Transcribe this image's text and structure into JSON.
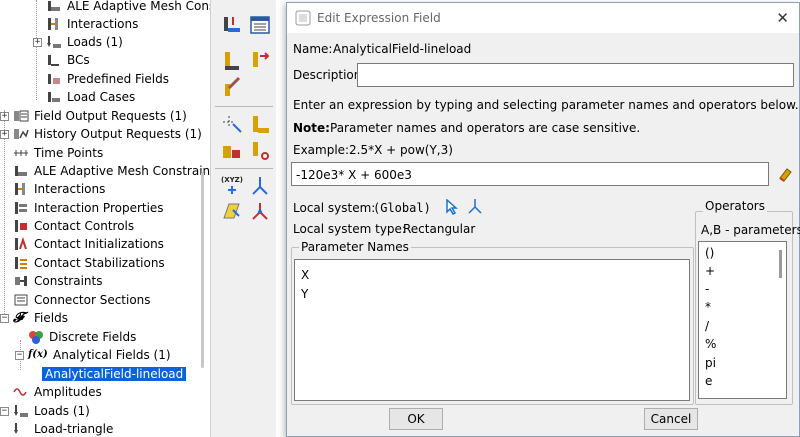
{
  "tree": {
    "items": [
      {
        "label": "ALE Adaptive Mesh Cons",
        "icon": "ale-mesh-icon"
      },
      {
        "label": "Interactions",
        "icon": "interaction-icon"
      },
      {
        "label": "Loads (1)",
        "icon": "load-icon"
      },
      {
        "label": "BCs",
        "icon": "bc-icon"
      },
      {
        "label": "Predefined Fields",
        "icon": "predefined-field-icon"
      },
      {
        "label": "Load Cases",
        "icon": "load-case-icon"
      },
      {
        "label": "Field Output Requests (1)",
        "icon": "field-output-icon"
      },
      {
        "label": "History Output Requests (1)",
        "icon": "history-output-icon"
      },
      {
        "label": "Time Points",
        "icon": "time-points-icon"
      },
      {
        "label": "ALE Adaptive Mesh Constraints",
        "icon": "ale-mesh-icon"
      },
      {
        "label": "Interactions",
        "icon": "interaction-icon"
      },
      {
        "label": "Interaction Properties",
        "icon": "interaction-property-icon"
      },
      {
        "label": "Contact Controls",
        "icon": "contact-control-icon"
      },
      {
        "label": "Contact Initializations",
        "icon": "contact-init-icon"
      },
      {
        "label": "Contact Stabilizations",
        "icon": "contact-stab-icon"
      },
      {
        "label": "Constraints",
        "icon": "constraint-icon"
      },
      {
        "label": "Connector Sections",
        "icon": "connector-icon"
      },
      {
        "label": "Fields",
        "icon": "fields-icon",
        "glyph": "𝓕"
      },
      {
        "label": "Discrete Fields",
        "icon": "discrete-field-icon"
      },
      {
        "label": "Analytical Fields (1)",
        "icon": "analytical-field-icon",
        "glyph": "f(x)"
      },
      {
        "label": "AnalyticalField-lineload",
        "icon": "",
        "selected": true
      },
      {
        "label": "Amplitudes",
        "icon": "amplitude-icon"
      },
      {
        "label": "Loads (1)",
        "icon": "load-icon"
      },
      {
        "label": "Load-triangle",
        "icon": "load-icon"
      }
    ]
  },
  "dialog": {
    "title": "Edit Expression Field",
    "name_label": "Name:",
    "name_value": "AnalyticalField-lineload",
    "description_label": "Description:",
    "description_value": "",
    "instruction": "Enter an expression by typing and selecting parameter names and operators below.",
    "note_label": "Note:",
    "note_text": "Parameter names and operators are case sensitive.",
    "example_label": "Example:",
    "example_value": "2.5*X + pow(Y,3)",
    "expression_value": "-120e3* X + 600e3",
    "local_system_label": "Local system:",
    "local_system_value": "(Global)",
    "local_system_type_label": "Local system type:",
    "local_system_type_value": "Rectangular",
    "parameter_names_title": "Parameter Names",
    "parameter_names": [
      "X",
      "Y"
    ],
    "operators_title": "Operators",
    "operators_header": "A,B - parameters",
    "operators": [
      "()",
      "+",
      "-",
      "*",
      "/",
      "%",
      "pi",
      "e"
    ],
    "ok_label": "OK",
    "cancel_label": "Cancel"
  },
  "colors": {
    "selection": "#0a64d8",
    "accent": "#1a73c8"
  }
}
